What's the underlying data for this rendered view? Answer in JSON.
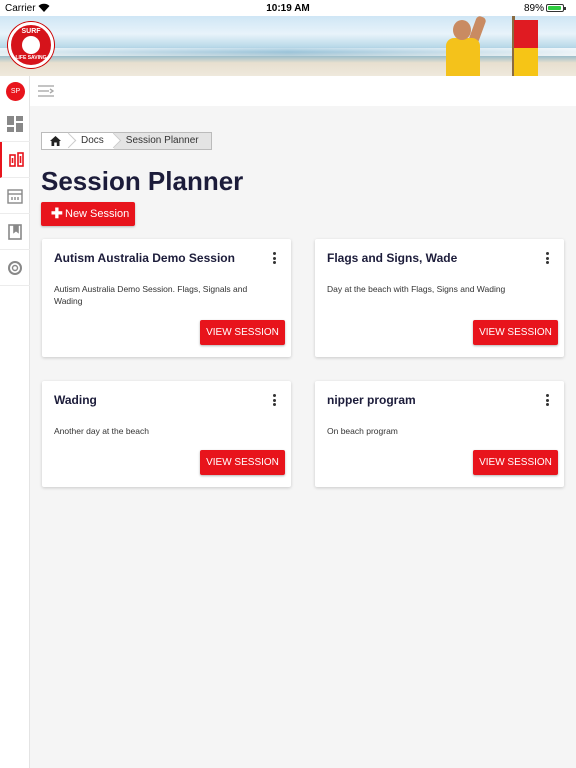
{
  "status": {
    "carrier": "Carrier",
    "time": "10:19 AM",
    "battery": "89%",
    "battery_level": 0.89
  },
  "logo": {
    "top_text": "SURF",
    "bottom_text": "LIFE SAVING"
  },
  "user": {
    "initials": "SP"
  },
  "sidebar": {
    "items": [
      {
        "icon": "dashboard-icon"
      },
      {
        "icon": "session-planner-icon",
        "active": true
      },
      {
        "icon": "building-icon"
      },
      {
        "icon": "book-icon"
      },
      {
        "icon": "lifebuoy-icon"
      }
    ]
  },
  "breadcrumb": {
    "items": [
      "Docs",
      "Session Planner"
    ]
  },
  "page": {
    "title": "Session Planner",
    "new_button": "New Session"
  },
  "sessions": [
    {
      "title": "Autism Australia Demo Session",
      "description": "Autism Australia Demo Session. Flags, Signals and Wading",
      "action": "VIEW SESSION"
    },
    {
      "title": "Flags and Signs, Wade",
      "description": "Day at the beach with Flags, Signs and Wading",
      "action": "VIEW SESSION"
    },
    {
      "title": "Wading",
      "description": "Another day at the beach",
      "action": "VIEW SESSION"
    },
    {
      "title": "nipper program",
      "description": "On beach program",
      "action": "VIEW SESSION"
    }
  ],
  "colors": {
    "accent": "#e8141c",
    "title": "#1c1c3a",
    "background": "#f5f5f5"
  }
}
